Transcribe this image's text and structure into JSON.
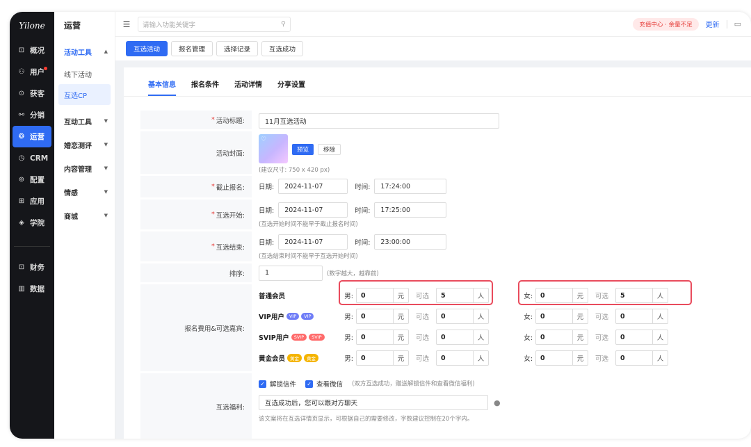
{
  "logo": "Yilone",
  "darknav": [
    {
      "label": "概况",
      "icon": "dashboard-icon",
      "glyph": "⊡"
    },
    {
      "label": "用户",
      "icon": "user-icon",
      "glyph": "⚇"
    },
    {
      "label": "获客",
      "icon": "acquire-icon",
      "glyph": "⊙"
    },
    {
      "label": "分销",
      "icon": "distribution-icon",
      "glyph": "⚯"
    },
    {
      "label": "运营",
      "icon": "operation-icon",
      "glyph": "❂"
    },
    {
      "label": "CRM",
      "icon": "crm-icon",
      "glyph": "◷"
    },
    {
      "label": "配置",
      "icon": "config-icon",
      "glyph": "⊚"
    },
    {
      "label": "应用",
      "icon": "apps-icon",
      "glyph": "⊞"
    },
    {
      "label": "学院",
      "icon": "academy-icon",
      "glyph": "◈"
    },
    {
      "label": "财务",
      "icon": "finance-icon",
      "glyph": "⊡"
    },
    {
      "label": "数据",
      "icon": "data-icon",
      "glyph": "▥"
    }
  ],
  "subnav": {
    "title": "运营",
    "items": [
      {
        "label": "活动工具",
        "expanded": true
      },
      {
        "label": "线下活动"
      },
      {
        "label": "互选CP"
      },
      {
        "label": "互动工具"
      },
      {
        "label": "婚恋测评"
      },
      {
        "label": "内容管理"
      },
      {
        "label": "情感"
      },
      {
        "label": "商城"
      }
    ]
  },
  "topbar": {
    "search_placeholder": "请输入功能关键字",
    "recharge": "充值中心 · 余量不足",
    "update": "更新"
  },
  "tabs": [
    "互选活动",
    "报名管理",
    "选择记录",
    "互选成功"
  ],
  "subtabs": [
    "基本信息",
    "报名条件",
    "活动详情",
    "分享设置"
  ],
  "form": {
    "title_label": "活动标题:",
    "title_value": "11月互选活动",
    "cover_label": "活动封面:",
    "cover_preview": "预览",
    "cover_remove": "移除",
    "cover_hint": "(建议尺寸: 750 x 420 px)",
    "deadline_label": "截止报名:",
    "start_label": "互选开始:",
    "end_label": "互选结束:",
    "date_key": "日期:",
    "time_key": "时间:",
    "deadline_date": "2024-11-07",
    "deadline_time": "17:24:00",
    "start_date": "2024-11-07",
    "start_time": "17:25:00",
    "start_hint": "(互选开始时间不能早于截止报名时间)",
    "end_date": "2024-11-07",
    "end_time": "23:00:00",
    "end_hint": "(互选结束时间不能早于互选开始时间)",
    "sort_label": "排序:",
    "sort_value": "1",
    "sort_hint": "(数字越大，越靠前)",
    "fee_label": "报名费用&可选嘉宾:",
    "male": "男:",
    "female": "女:",
    "yuan": "元",
    "optional": "可选",
    "person": "人",
    "fees": [
      {
        "name": "普通会员",
        "badges": [],
        "m_fee": "0",
        "m_cnt": "5",
        "f_fee": "0",
        "f_cnt": "5"
      },
      {
        "name": "VIP用户",
        "badges": [
          "VIP",
          "VIP"
        ],
        "badge_type": "vip",
        "m_fee": "0",
        "m_cnt": "0",
        "f_fee": "0",
        "f_cnt": "0"
      },
      {
        "name": "SVIP用户",
        "badges": [
          "SVIP",
          "SVIP"
        ],
        "badge_type": "svip",
        "m_fee": "0",
        "m_cnt": "0",
        "f_fee": "0",
        "f_cnt": "0"
      },
      {
        "name": "黄金会员",
        "badges": [
          "黄金",
          "黄金"
        ],
        "badge_type": "gold",
        "m_fee": "0",
        "m_cnt": "0",
        "f_fee": "0",
        "f_cnt": "0"
      }
    ],
    "unlock_letter": "解锁信件",
    "view_wechat": "查看微信",
    "benefit_note": "(双方互选成功，赠送解锁信件和查看微信福利)",
    "benefit_label": "互选福利:",
    "benefit_value": "互选成功后，您可以跟对方聊天",
    "benefit_hint": "该文案将在互选详情页显示，可根据自己的需要修改，字数建议控制在20个字内。"
  },
  "colors": {
    "accent": "#2f6bf3",
    "highlight": "#e94b5c"
  }
}
